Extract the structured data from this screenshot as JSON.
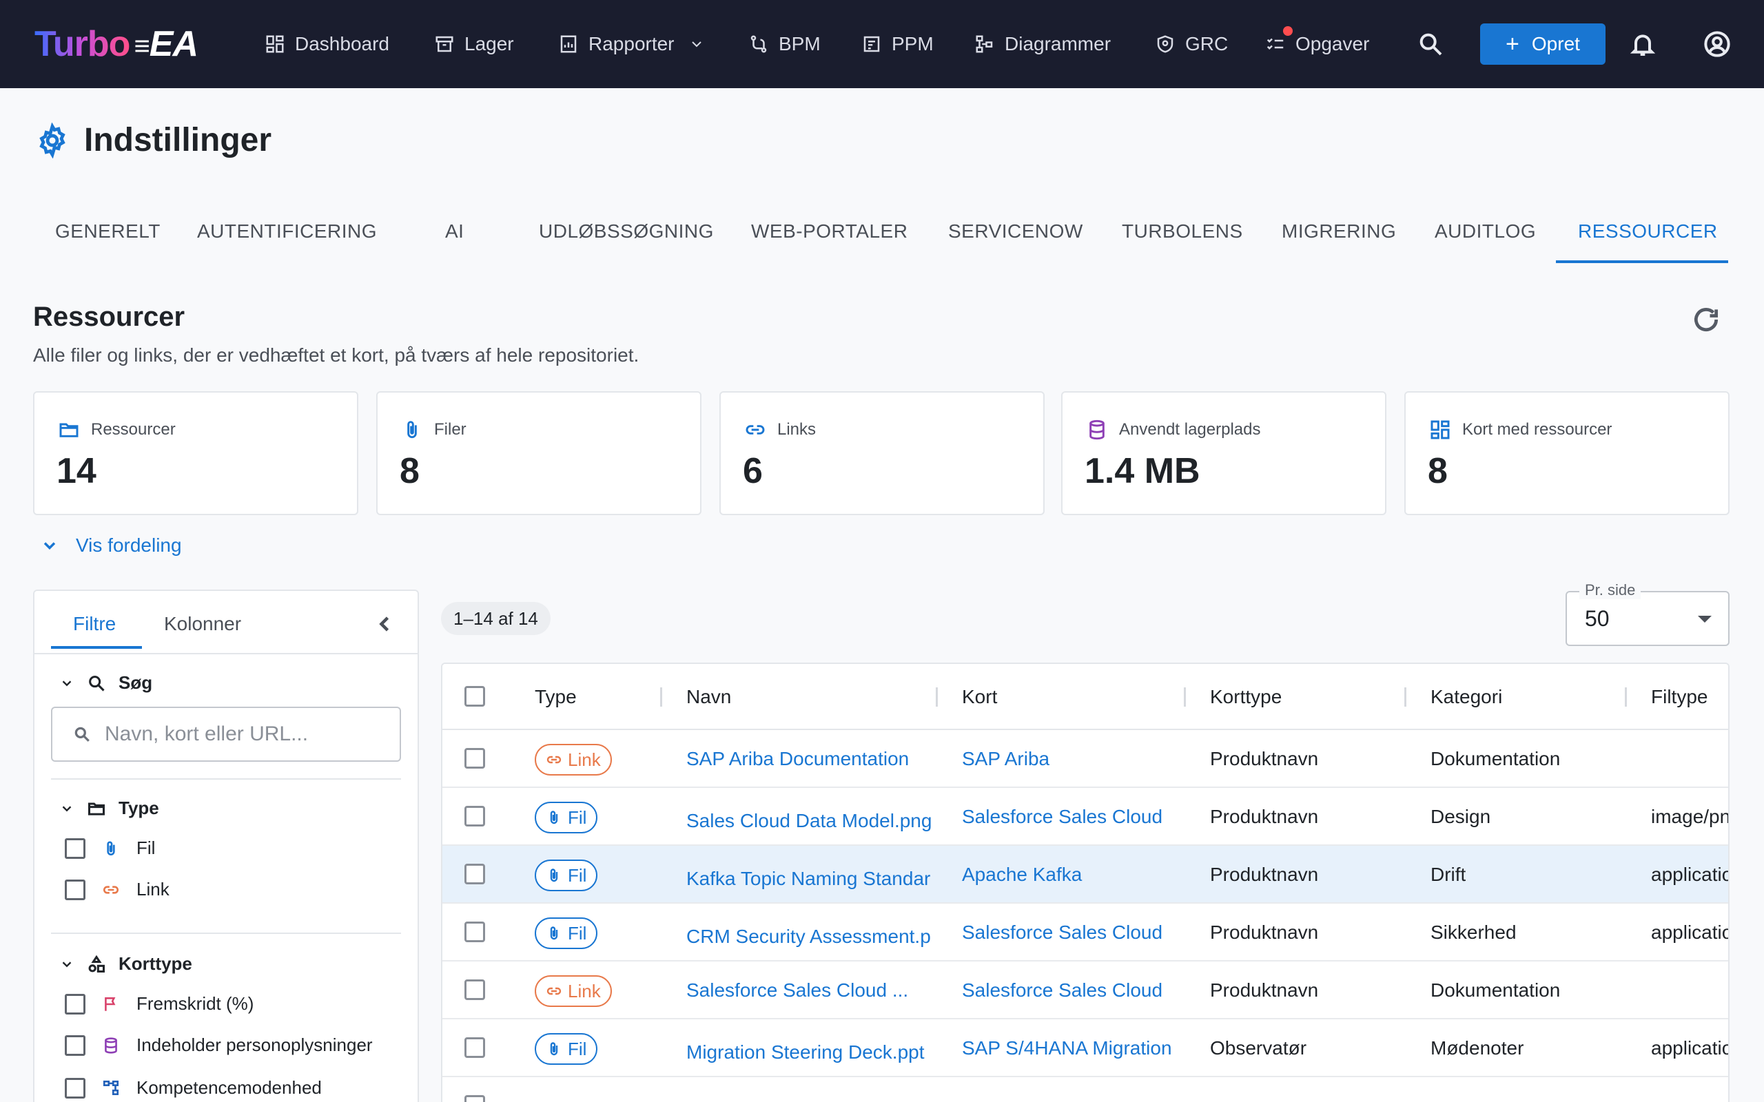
{
  "app": {
    "logo_part1": "Turbo",
    "logo_part2": "EA",
    "nav": [
      {
        "label": "Dashboard",
        "icon": "dashboard-icon"
      },
      {
        "label": "Lager",
        "icon": "archive-icon"
      },
      {
        "label": "Rapporter",
        "icon": "report-icon"
      },
      {
        "label": "BPM",
        "icon": "flow-icon"
      },
      {
        "label": "PPM",
        "icon": "project-icon"
      },
      {
        "label": "Diagrammer",
        "icon": "diagram-icon"
      },
      {
        "label": "GRC",
        "icon": "shield-icon"
      },
      {
        "label": "Opgaver",
        "icon": "tasks-icon"
      }
    ],
    "create_label": "Opret"
  },
  "page": {
    "title": "Indstillinger"
  },
  "tabs": [
    "GENERELT",
    "AUTENTIFICERING",
    "AI",
    "UDLØBSSØGNING",
    "WEB-PORTALER",
    "SERVICENOW",
    "TURBOLENS",
    "MIGRERING",
    "AUDITLOG",
    "RESSOURCER"
  ],
  "active_tab": "RESSOURCER",
  "section": {
    "title": "Ressourcer",
    "subtitle": "Alle filer og links, der er vedhæftet et kort, på tværs af hele repositoriet."
  },
  "stats": [
    {
      "label": "Ressourcer",
      "value": "14",
      "icon": "folder-icon",
      "color": "#1976d2"
    },
    {
      "label": "Filer",
      "value": "8",
      "icon": "paperclip-icon",
      "color": "#1976d2"
    },
    {
      "label": "Links",
      "value": "6",
      "icon": "link-icon",
      "color": "#1976d2"
    },
    {
      "label": "Anvendt lagerplads",
      "value": "1.4 MB",
      "icon": "database-icon",
      "color": "#8e3fb5"
    },
    {
      "label": "Kort med ressourcer",
      "value": "8",
      "icon": "grid-icon",
      "color": "#1976d2"
    }
  ],
  "distribution_toggle": "Vis fordeling",
  "filters": {
    "tab_filters": "Filtre",
    "tab_columns": "Kolonner",
    "search_section": "Søg",
    "search_placeholder": "Navn, kort eller URL...",
    "type_section": "Type",
    "type_options": [
      "Fil",
      "Link"
    ],
    "cardtype_section": "Korttype",
    "cardtype_options": [
      "Fremskridt (%)",
      "Indeholder personoplysninger",
      "Kompetencemodenhed"
    ]
  },
  "results": {
    "count": "1–14 af 14",
    "per_page_label": "Pr. side",
    "per_page_value": "50"
  },
  "table": {
    "columns": [
      "Type",
      "Navn",
      "Kort",
      "Korttype",
      "Kategori",
      "Filtype"
    ],
    "rows": [
      {
        "type": "Link",
        "name": "SAP Ariba Documentation",
        "card": "SAP Ariba",
        "cardtype": "Produktnavn",
        "category": "Dokumentation",
        "filetype": ""
      },
      {
        "type": "Fil",
        "name": "Sales Cloud Data Model.png",
        "card": "Salesforce Sales Cloud",
        "cardtype": "Produktnavn",
        "category": "Design",
        "filetype": "image/pn"
      },
      {
        "type": "Fil",
        "name": "Kafka Topic Naming Standar",
        "card": "Apache Kafka",
        "cardtype": "Produktnavn",
        "category": "Drift",
        "filetype": "applicatio"
      },
      {
        "type": "Fil",
        "name": "CRM Security Assessment.p",
        "card": "Salesforce Sales Cloud",
        "cardtype": "Produktnavn",
        "category": "Sikkerhed",
        "filetype": "applicatio"
      },
      {
        "type": "Link",
        "name": "Salesforce Sales Cloud ...",
        "card": "Salesforce Sales Cloud",
        "cardtype": "Produktnavn",
        "category": "Dokumentation",
        "filetype": ""
      },
      {
        "type": "Fil",
        "name": "Migration Steering Deck.ppt",
        "card": "SAP S/4HANA Migration",
        "cardtype": "Observatør",
        "category": "Mødenoter",
        "filetype": "applicatio"
      }
    ]
  }
}
